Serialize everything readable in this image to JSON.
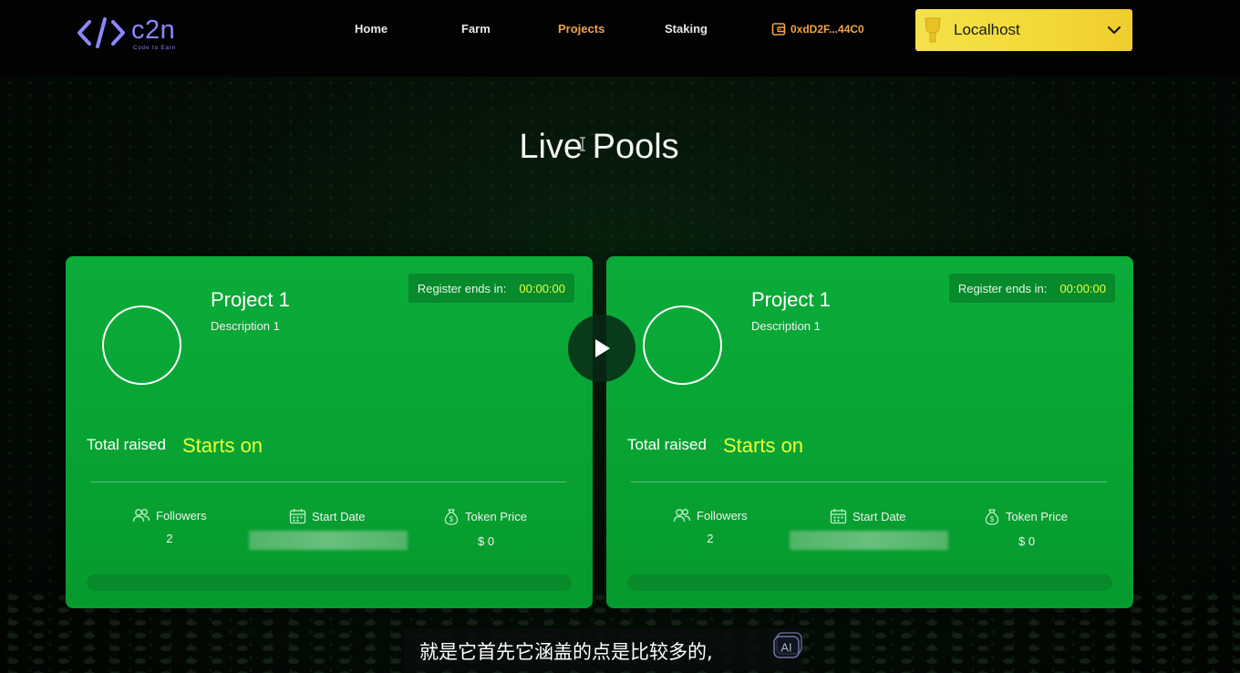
{
  "header": {
    "logo": {
      "text": "c2n",
      "tagline": "Code to Earn"
    },
    "nav": [
      {
        "label": "Home",
        "active": false
      },
      {
        "label": "Farm",
        "active": false
      },
      {
        "label": "Projects",
        "active": true
      },
      {
        "label": "Staking",
        "active": false
      }
    ],
    "wallet": {
      "address": "0xdD2F...44C0",
      "icon": "wallet-icon"
    },
    "network": {
      "label": "Localhost",
      "icon": "network-icon"
    }
  },
  "main": {
    "title": "Live Pools",
    "cards": [
      {
        "title": "Project 1",
        "description": "Description 1",
        "register_label": "Register ends in:",
        "register_time": "00:00:00",
        "raised_label": "Total raised",
        "raised_value": "Starts on",
        "stats": {
          "followers": {
            "label": "Followers",
            "value": "2"
          },
          "start_date": {
            "label": "Start Date",
            "value": ""
          },
          "token_price": {
            "label": "Token Price",
            "value": "$ 0"
          }
        },
        "progress": 0
      },
      {
        "title": "Project 1",
        "description": "Description 1",
        "register_label": "Register ends in:",
        "register_time": "00:00:00",
        "raised_label": "Total raised",
        "raised_value": "Starts on",
        "stats": {
          "followers": {
            "label": "Followers",
            "value": "2"
          },
          "start_date": {
            "label": "Start Date",
            "value": ""
          },
          "token_price": {
            "label": "Token Price",
            "value": "$ 0"
          }
        },
        "progress": 0
      }
    ]
  },
  "overlay": {
    "subtitle": "就是它首先它涵盖的点是比较多的,",
    "ai_badge": "AI"
  },
  "colors": {
    "accent_yellow": "#e8ff3a",
    "card_green": "#0bab3a",
    "nav_active": "#f0a24a",
    "network_yellow": "#f5e14a",
    "logo_purple": "#8e86ff"
  }
}
